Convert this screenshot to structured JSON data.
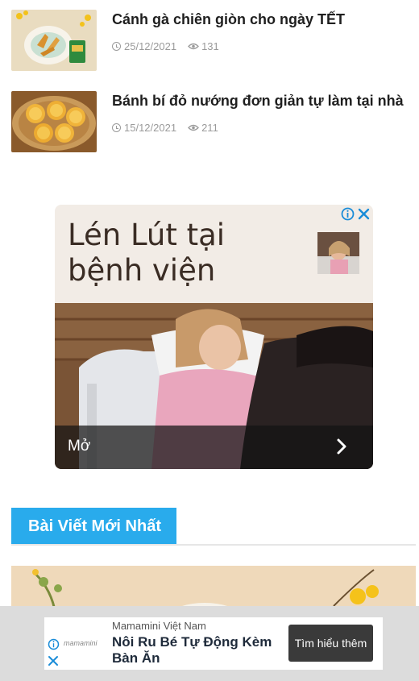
{
  "articles": [
    {
      "title": "Cánh gà chiên giòn cho ngày TẾT",
      "date": "25/12/2021",
      "views": "131",
      "thumb_icon": "fried-chicken-wings-photo"
    },
    {
      "title": "Bánh bí đỏ nướng đơn giản tự làm tại nhà",
      "date": "15/12/2021",
      "views": "211",
      "thumb_icon": "pumpkin-cakes-photo"
    }
  ],
  "ad": {
    "headline_line1": "Lén Lút tại",
    "headline_line2": "bệnh viện",
    "open_label": "Mở",
    "info_icon": "adchoices-info-icon",
    "close_icon": "close-icon",
    "accent_color": "#1a8cd8"
  },
  "section": {
    "title": "Bài Viết Mới Nhất",
    "color": "#29abec"
  },
  "sticky_ad": {
    "brand": "Mamamini Việt Nam",
    "title": "Nôi Ru Bé Tự Động Kèm Bàn Ăn",
    "cta": "Tìm hiểu thêm",
    "logo_text": "mamamini"
  }
}
